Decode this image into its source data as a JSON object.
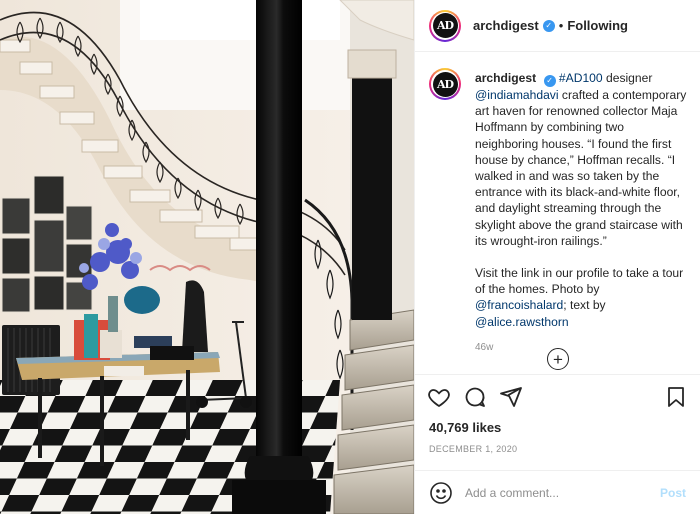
{
  "post": {
    "image_alt": "Entrance hall with wrought-iron staircase, checkered floor, black column and table",
    "header": {
      "avatar_text": "AD",
      "username": "archdigest",
      "verified": true,
      "separator": "•",
      "follow_status": "Following"
    },
    "caption": {
      "username": "archdigest",
      "hashtag": "#AD100",
      "text_1": " designer ",
      "mention_designer": "@indiamahdavi",
      "text_2": " crafted a contemporary art haven for renowned collector Maja Hoffmann by combining two neighboring houses. “I found the first house by chance,” Hoffman recalls. “I walked in and was so taken by the entrance with its black-and-white floor, and daylight streaming through the skylight above the grand staircase with its wrought-iron railings.”",
      "text_3": "Visit the link in our profile to take a tour of the homes. Photo by ",
      "mention_photographer": "@francoishalard",
      "text_4": "; text by ",
      "mention_writer": "@alice.rawsthorn",
      "time_ago": "46w"
    },
    "more_comments_icon": "plus-circle-icon",
    "likes": "40,769 likes",
    "date": "DECEMBER 1, 2020",
    "comment": {
      "placeholder": "Add a comment...",
      "post_label": "Post"
    },
    "colors": {
      "link": "#00376b",
      "verified": "#3897f0",
      "post_button": "#b2dffc",
      "muted": "#8e8e8e"
    }
  }
}
